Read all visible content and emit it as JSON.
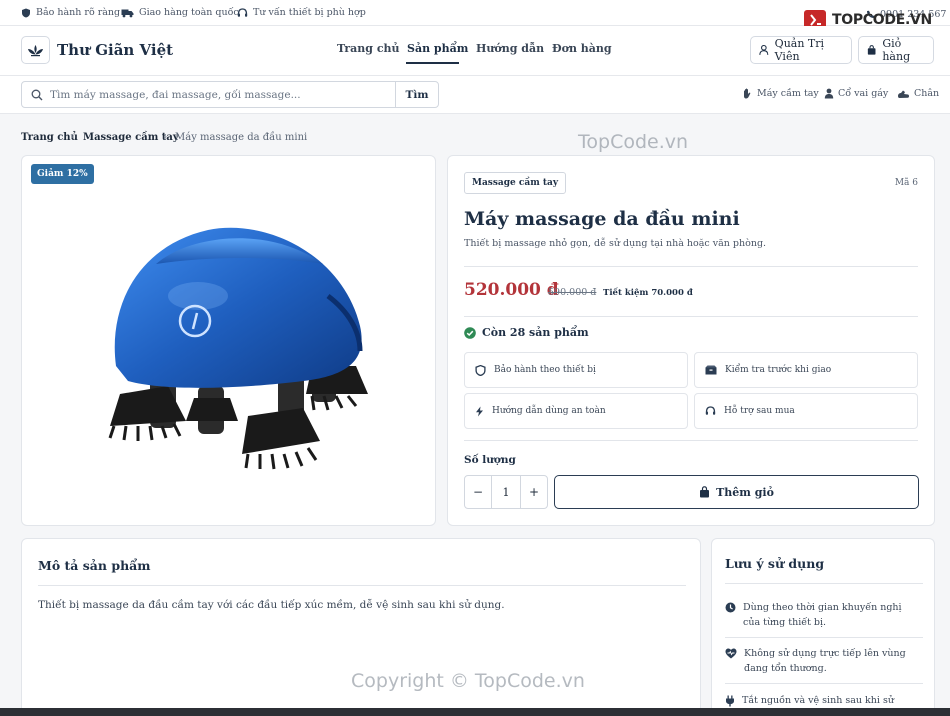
{
  "topstrip": {
    "warranty": "Bảo hành rõ ràng",
    "shipping": "Giao hàng toàn quốc",
    "advice": "Tư vấn thiết bị phù hợp",
    "phone": "0901 234 567"
  },
  "header": {
    "brand": "Thư Giãn Việt",
    "nav": [
      "Trang chủ",
      "Sản phẩm",
      "Hướng dẫn",
      "Đơn hàng"
    ],
    "admin_label": "Quản Trị Viên",
    "cart_label": "Giỏ hàng"
  },
  "search": {
    "placeholder": "Tìm máy massage, đai massage, gối massage...",
    "button": "Tìm"
  },
  "categories": [
    "Máy cầm tay",
    "Cổ vai gáy",
    "Chân"
  ],
  "breadcrumb": [
    "Trang chủ",
    "Massage cầm tay",
    "Máy massage da đầu mini"
  ],
  "product": {
    "discount_badge": "Giảm 12%",
    "category_tag": "Massage cầm tay",
    "code": "Mã 6",
    "title": "Máy massage da đầu mini",
    "short_desc": "Thiết bị massage nhỏ gọn, dễ sử dụng tại nhà hoặc văn phòng.",
    "price": "520.000 đ",
    "old_price": "590.000 đ",
    "saving": "Tiết kiệm 70.000 đ",
    "stock": "Còn 28 sản phẩm",
    "features": [
      "Bảo hành theo thiết bị",
      "Kiểm tra trước khi giao",
      "Hướng dẫn dùng an toàn",
      "Hỗ trợ sau mua"
    ],
    "quantity_label": "Số lượng",
    "quantity": "1",
    "minus": "−",
    "plus": "+",
    "add_to_cart": "Thêm giỏ"
  },
  "description": {
    "title": "Mô tả sản phẩm",
    "text": "Thiết bị massage da đầu cầm tay với các đầu tiếp xúc mềm, dễ vệ sinh sau khi sử dụng."
  },
  "usage": {
    "title": "Lưu ý sử dụng",
    "notes": [
      "Dùng theo thời gian khuyến nghị của từng thiết bị.",
      "Không sử dụng trực tiếp lên vùng đang tổn thương.",
      "Tắt nguồn và vệ sinh sau khi sử dụng."
    ]
  },
  "watermark": {
    "center": "TopCode.vn",
    "bottom": "Copyright © TopCode.vn",
    "corner": "TOPCODE.VN"
  },
  "colors": {
    "primary": "#1e2f45",
    "price": "#b3343a",
    "badge": "#2e6fa3",
    "product": "#1f5fbf"
  }
}
